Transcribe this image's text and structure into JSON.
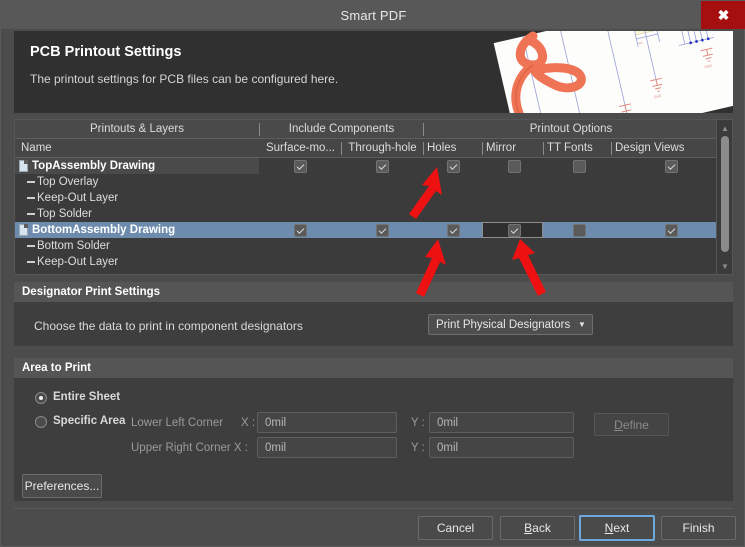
{
  "window": {
    "title": "Smart PDF",
    "close_label": "✖"
  },
  "banner": {
    "title": "PCB Printout Settings",
    "subtitle": "The printout settings for PCB files can be configured here."
  },
  "tree": {
    "group_headers": [
      {
        "label": "Printouts & Layers"
      },
      {
        "label": "Include Components"
      },
      {
        "label": "Printout Options"
      }
    ],
    "columns": [
      {
        "label": "Name"
      },
      {
        "label": "Surface-mo..."
      },
      {
        "label": "Through-hole"
      },
      {
        "label": "Holes"
      },
      {
        "label": "Mirror"
      },
      {
        "label": "TT Fonts"
      },
      {
        "label": "Design Views"
      }
    ],
    "rows": [
      {
        "label": "TopAssembly Drawing",
        "type": "group",
        "selected": false,
        "label_highlight": true,
        "checks": [
          true,
          true,
          true,
          false,
          false,
          true
        ],
        "focus_col": -1
      },
      {
        "label": "Top Overlay",
        "type": "child",
        "selected": false,
        "checks": []
      },
      {
        "label": "Keep-Out Layer",
        "type": "child",
        "selected": false,
        "checks": []
      },
      {
        "label": "Top Solder",
        "type": "child",
        "selected": false,
        "checks": []
      },
      {
        "label": "BottomAssembly Drawing",
        "type": "group",
        "selected": true,
        "checks": [
          true,
          true,
          true,
          true,
          false,
          true
        ],
        "focus_col": 3
      },
      {
        "label": "Bottom Solder",
        "type": "child",
        "selected": false,
        "checks": []
      },
      {
        "label": "Keep-Out Layer",
        "type": "child",
        "selected": false,
        "checks": []
      }
    ],
    "scroll_up_icon": "▲",
    "scroll_down_icon": "▼"
  },
  "designator_section": {
    "title": "Designator Print Settings",
    "prompt": "Choose the data to print in component designators",
    "dropdown_value": "Print Physical Designators",
    "dropdown_caret": "▼"
  },
  "area_section": {
    "title": "Area to Print",
    "entire_sheet_label": "Entire Sheet",
    "entire_sheet_selected": true,
    "specific_area_label": "Specific Area",
    "specific_area_selected": false,
    "lower_left_label": "Lower Left Corner",
    "upper_right_label": "Upper Right Corner X :",
    "x_label": "X :",
    "y_label": "Y :",
    "lower_left_x": "0mil",
    "lower_left_y": "0mil",
    "upper_right_x": "0mil",
    "upper_right_y": "0mil",
    "define_label": "Define"
  },
  "footer": {
    "preferences_label": "Preferences...",
    "cancel_label": "Cancel",
    "back_label": "Back",
    "back_accel": "B",
    "next_label": "Next",
    "next_accel": "N",
    "finish_label": "Finish"
  },
  "colors": {
    "accent_selection": "#6d8cad",
    "close_red": "#a50f0f",
    "focus_blue": "#6fa8dc",
    "annotation_red": "#ee1111"
  }
}
